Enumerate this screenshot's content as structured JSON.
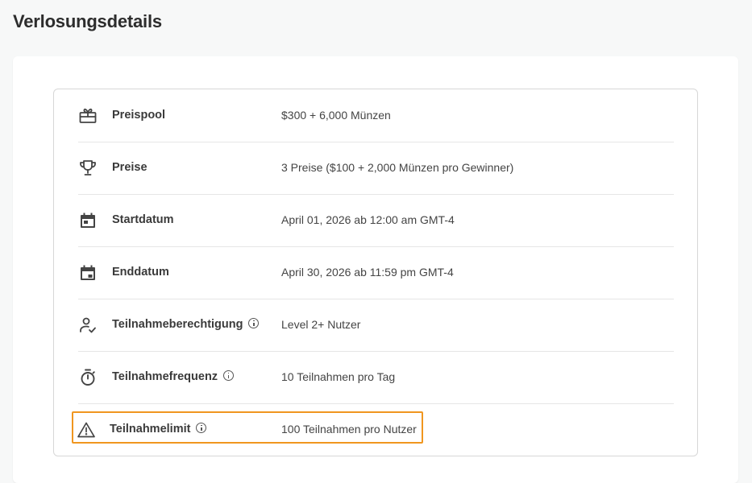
{
  "page": {
    "title": "Verlosungsdetails"
  },
  "details": {
    "rows": [
      {
        "icon": "gift-icon",
        "label": "Preispool",
        "value": "$300 + 6,000 Münzen",
        "info": false
      },
      {
        "icon": "trophy-icon",
        "label": "Preise",
        "value": "3 Preise ($100 + 2,000 Münzen pro Gewinner)",
        "info": false
      },
      {
        "icon": "calendar-start-icon",
        "label": "Startdatum",
        "value": "April 01, 2026 ab 12:00 am GMT-4",
        "info": false
      },
      {
        "icon": "calendar-end-icon",
        "label": "Enddatum",
        "value": "April 30, 2026 ab 11:59 pm GMT-4",
        "info": false
      },
      {
        "icon": "user-check-icon",
        "label": "Teilnahmeberechtigung",
        "value": "Level 2+ Nutzer",
        "info": true
      },
      {
        "icon": "stopwatch-icon",
        "label": "Teilnahmefrequenz",
        "value": "10 Teilnahmen pro Tag",
        "info": true
      },
      {
        "icon": "warning-icon",
        "label": "Teilnahmelimit",
        "value": "100 Teilnahmen pro Nutzer",
        "info": true
      }
    ]
  },
  "colors": {
    "highlight": "#f0961f",
    "background": "#f7f8f8",
    "border": "#d7d7d7"
  }
}
